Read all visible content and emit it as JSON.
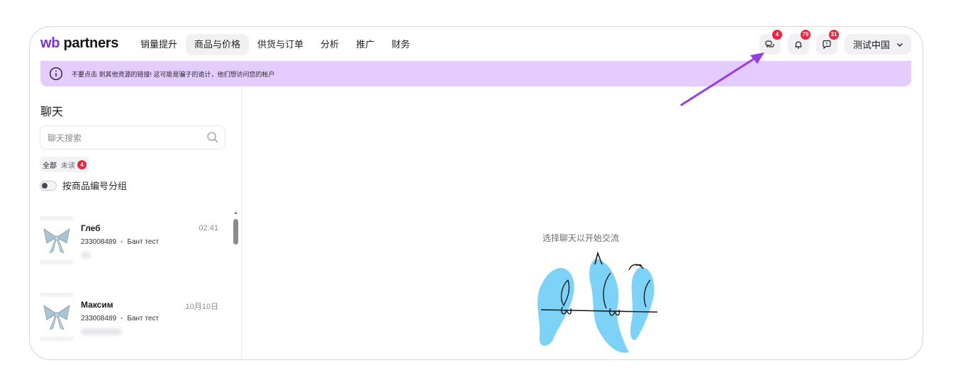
{
  "header": {
    "logo_wb": "wb",
    "logo_partners": "partners",
    "nav": [
      "销量提升",
      "商品与价格",
      "供货与订单",
      "分析",
      "推广",
      "财务"
    ],
    "active_nav_index": 1,
    "chats_badge": "4",
    "notifications_badge": "79",
    "feedback_badge": "31",
    "shop_name": "测试中国"
  },
  "banner": {
    "text": "不要点击 到其他资源的链接! 这可能是骗子的诡计，他们想访问您的帐户"
  },
  "chat_panel": {
    "title": "聊天",
    "search_placeholder": "聊天搜索",
    "filter_all": "全部",
    "filter_unread": "未读",
    "unread_count": "4",
    "group_toggle_label": "按商品编号分组",
    "group_toggle_on": false,
    "chats": [
      {
        "name": "Глеб",
        "time": "02:41",
        "article": "233008489",
        "product": "Бант тест"
      },
      {
        "name": "Максим",
        "time": "10月10日",
        "article": "233008489",
        "product": "Бант тест"
      }
    ]
  },
  "main": {
    "empty_text": "选择聊天以开始交流"
  },
  "colors": {
    "brand": "#7c2fe0",
    "banner_bg": "#e4ccff",
    "badge": "#f0243f",
    "annotation_arrow": "#9340e8",
    "birds": "#7dd3f7"
  },
  "icons": [
    "chat-icon",
    "bell-icon",
    "feedback-icon",
    "chevron-down-icon",
    "info-icon",
    "search-icon"
  ]
}
